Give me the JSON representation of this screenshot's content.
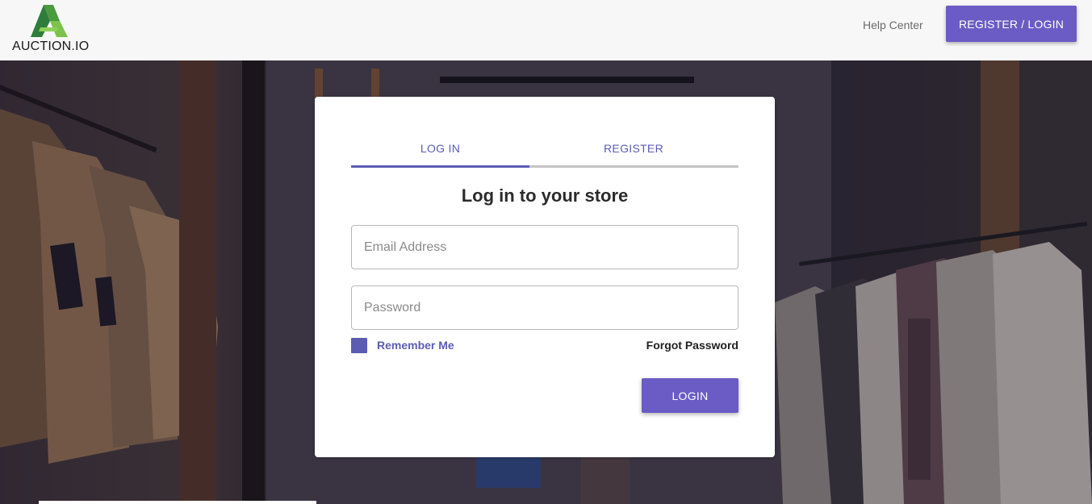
{
  "header": {
    "logo_text": "AUCTION.IO",
    "help_link": "Help Center",
    "cta_button": "REGISTER / LOGIN"
  },
  "card": {
    "tabs": [
      {
        "label": "LOG IN",
        "active": true
      },
      {
        "label": "REGISTER",
        "active": false
      }
    ],
    "title": "Log in to your store",
    "email": {
      "value": "",
      "placeholder": "Email Address"
    },
    "password": {
      "value": "",
      "placeholder": "Password"
    },
    "remember_label": "Remember Me",
    "remember_checked": true,
    "forgot_link": "Forgot Password",
    "submit_label": "LOGIN"
  },
  "colors": {
    "accent": "#6b5bc4",
    "tab_accent": "#5c5cb5",
    "logo_green_dark": "#2f7d3a",
    "logo_green_light": "#7cc24c"
  },
  "icons": {
    "logo": "auction-logo-icon"
  }
}
